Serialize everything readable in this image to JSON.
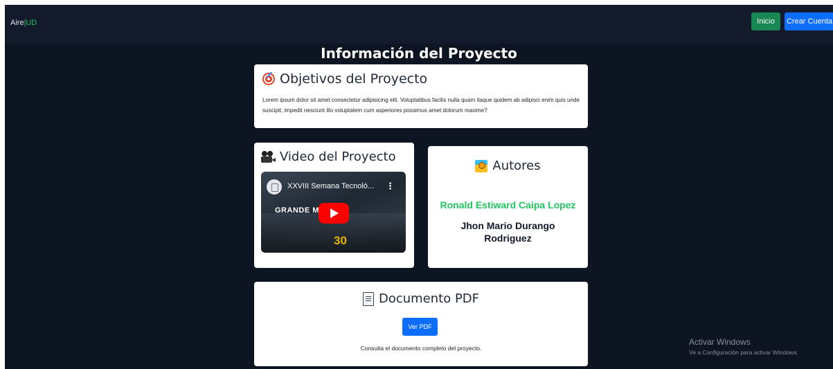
{
  "navbar": {
    "brand_main": "Aire",
    "brand_separator": "|",
    "brand_accent": "UD",
    "inicio_label": "Inicio",
    "crear_cuenta_label": "Crear Cuenta"
  },
  "page": {
    "title": "Información del Proyecto"
  },
  "objetivos": {
    "icon": "target-icon",
    "title": "Objetivos del Proyecto",
    "text": "Lorem ipsum dolor sit amet consectetur adipisicing elit. Voluptatibus facilis nulla quam itaque quidem ab adipisci enim quis unde suscipit, impedit nesciunt illo voluptatem cum asperiores possimus amet dolorum maxime?"
  },
  "video": {
    "icon": "film-camera-icon",
    "title": "Video del Proyecto",
    "player_title": "XXVIII Semana Tecnoló...",
    "menu": "⋮",
    "overlay_text": "GRANDE          MENTOS",
    "badge": "30"
  },
  "autores": {
    "icon": "people-icon",
    "title": "Autores",
    "author1": "Ronald Estiward Caipa Lopez",
    "author2": "Jhon Mario Durango Rodriguez"
  },
  "pdf": {
    "icon": "document-icon",
    "title": "Documento PDF",
    "button_label": "Ver PDF",
    "description": "Consulta el documento completo del proyecto."
  },
  "windows_watermark": {
    "title": "Activar Windows",
    "subtitle": "Ve a Configuración para activar Windows."
  },
  "colors": {
    "background": "#0d1422",
    "navbar": "#121a2b",
    "accent_green": "#22c55e",
    "button_green": "#198754",
    "button_blue": "#0d6efd"
  }
}
